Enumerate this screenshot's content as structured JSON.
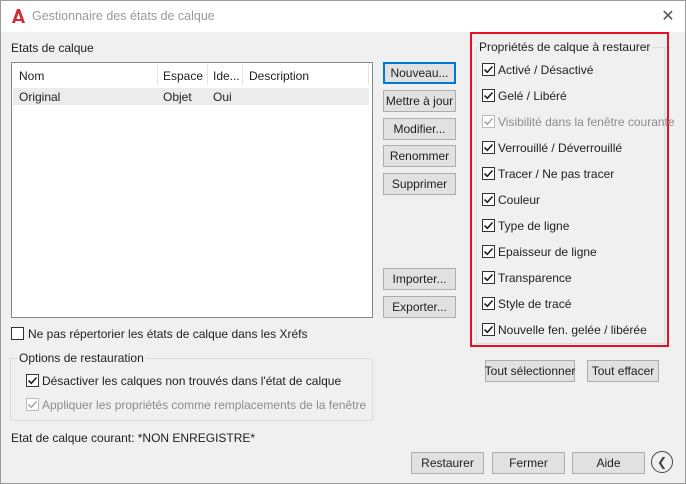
{
  "window": {
    "title": "Gestionnaire des états de calque",
    "close_glyph": "✕",
    "app_icon": "autocad-a-icon",
    "accent_color": "#e81123"
  },
  "states_panel": {
    "title": "Etats de calque",
    "columns": [
      "Nom",
      "Espace",
      "Ide...",
      "Description"
    ],
    "rows": [
      {
        "nom": "Original",
        "espace": "Objet",
        "ide": "Oui",
        "description": ""
      }
    ]
  },
  "buttons": {
    "nouveau": "Nouveau...",
    "mettre_a_jour": "Mettre à jour",
    "modifier": "Modifier...",
    "renommer": "Renommer",
    "supprimer": "Supprimer",
    "importer": "Importer...",
    "exporter": "Exporter...",
    "tout_selectionner": "Tout sélectionner",
    "tout_effacer": "Tout effacer",
    "restaurer": "Restaurer",
    "fermer": "Fermer",
    "aide": "Aide"
  },
  "xref_option": {
    "label": "Ne pas répertorier les états de calque dans les Xréfs",
    "checked": false
  },
  "restore_options": {
    "title": "Options de restauration",
    "items": [
      {
        "label": "Désactiver les calques non trouvés dans l'état de calque",
        "checked": true,
        "disabled": false
      },
      {
        "label": "Appliquer les propriétés comme remplacements de la fenêtre",
        "checked": true,
        "disabled": true
      }
    ]
  },
  "current_state": {
    "label": "Etat de calque courant: *NON ENREGISTRE*"
  },
  "properties": {
    "title": "Propriétés de calque à restaurer",
    "items": [
      {
        "label": "Activé / Désactivé",
        "checked": true,
        "disabled": false
      },
      {
        "label": "Gelé / Libéré",
        "checked": true,
        "disabled": false
      },
      {
        "label": "Visibilité dans la fenêtre courante",
        "checked": true,
        "disabled": true
      },
      {
        "label": "Verrouillé / Déverrouillé",
        "checked": true,
        "disabled": false
      },
      {
        "label": "Tracer / Ne pas tracer",
        "checked": true,
        "disabled": false
      },
      {
        "label": "Couleur",
        "checked": true,
        "disabled": false
      },
      {
        "label": "Type de ligne",
        "checked": true,
        "disabled": false
      },
      {
        "label": "Epaisseur de ligne",
        "checked": true,
        "disabled": false
      },
      {
        "label": "Transparence",
        "checked": true,
        "disabled": false
      },
      {
        "label": "Style de tracé",
        "checked": true,
        "disabled": false
      },
      {
        "label": "Nouvelle fen. gelée / libérée",
        "checked": true,
        "disabled": false
      }
    ]
  },
  "footer": {
    "back_icon": "circle-chevron-left-icon",
    "back_glyph": "❮"
  }
}
